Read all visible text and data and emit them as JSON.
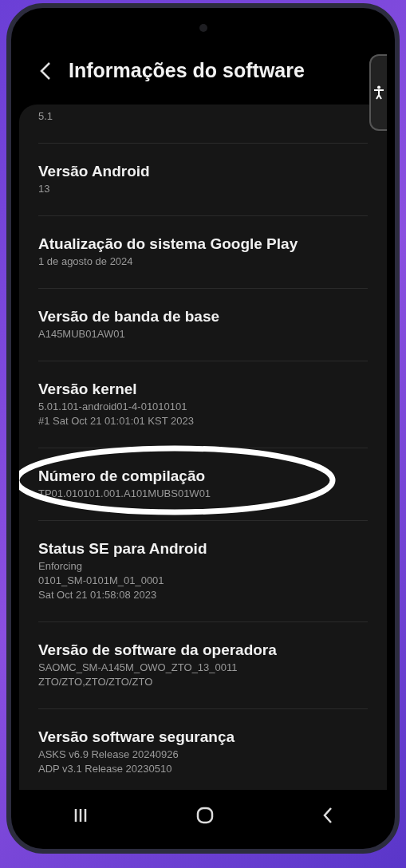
{
  "header": {
    "title": "Informações do software"
  },
  "items": [
    {
      "lines": [
        "5.1"
      ],
      "highlighted": false
    },
    {
      "title": "Versão Android",
      "lines": [
        "13"
      ],
      "highlighted": false
    },
    {
      "title": "Atualização do sistema Google Play",
      "lines": [
        "1 de agosto de 2024"
      ],
      "highlighted": false
    },
    {
      "title": "Versão de banda de base",
      "lines": [
        "A145MUB01AW01"
      ],
      "highlighted": false
    },
    {
      "title": "Versão kernel",
      "lines": [
        "5.01.101-android01-4-01010101",
        "#1 Sat Oct 21 01:01:01 KST 2023"
      ],
      "highlighted": false
    },
    {
      "title": "Número de compilação",
      "lines": [
        "TP01.010101.001.A101MUBS01W01"
      ],
      "highlighted": true
    },
    {
      "title": "Status SE para Android",
      "lines": [
        "Enforcing",
        "0101_SM-0101M_01_0001",
        "Sat Oct 21 01:58:08 2023"
      ],
      "highlighted": false
    },
    {
      "title": "Versão de software da operadora",
      "lines": [
        "SAOMC_SM-A145M_OWO_ZTO_13_0011",
        "ZTO/ZTO,ZTO/ZTO/ZTO"
      ],
      "highlighted": false
    },
    {
      "title": "Versão software segurança",
      "lines": [
        "ASKS v6.9 Release 20240926",
        "ADP v3.1 Release 20230510"
      ],
      "highlighted": false
    }
  ]
}
